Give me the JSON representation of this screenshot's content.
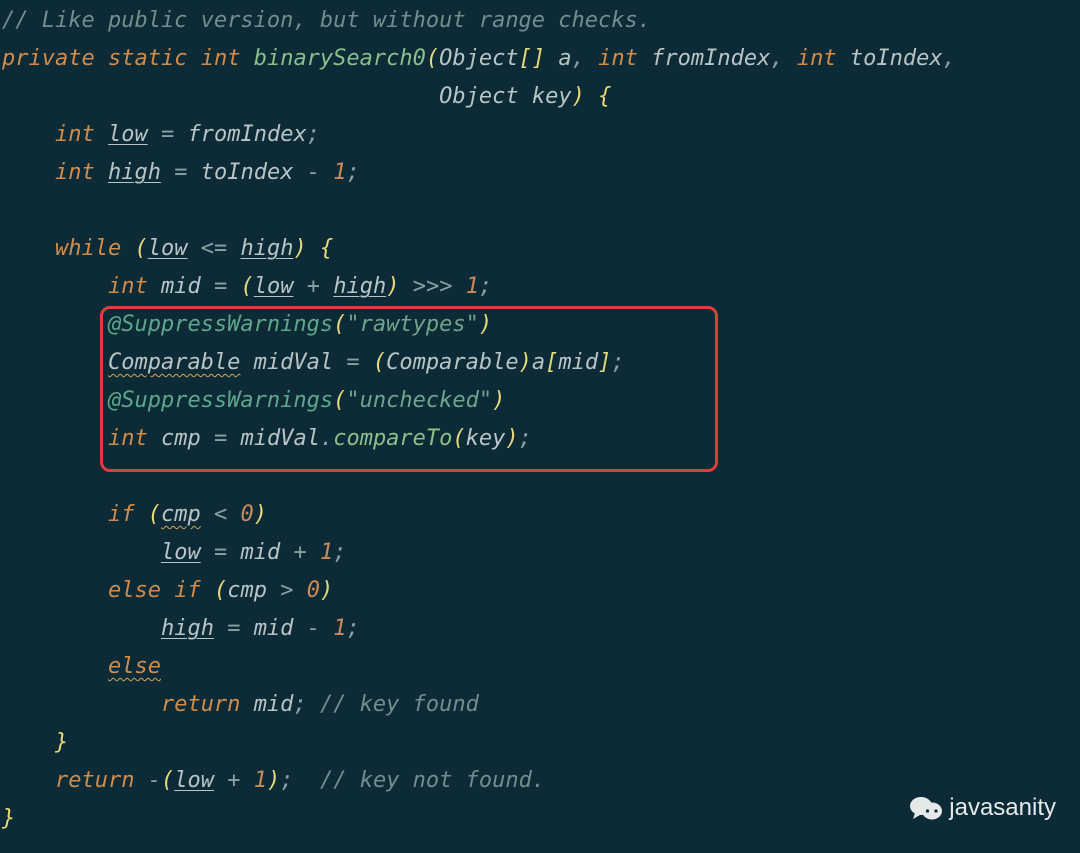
{
  "code": {
    "comment_top": "// Like public version, but without range checks.",
    "kw_private": "private",
    "kw_static": "static",
    "kw_int": "int",
    "method_name": "binarySearch0",
    "type_object": "Object",
    "param_a": "a",
    "param_fromIndex": "fromIndex",
    "param_toIndex": "toIndex",
    "param_key": "key",
    "var_low": "low",
    "var_high": "high",
    "var_mid": "mid",
    "kw_while": "while",
    "kw_if": "if",
    "kw_else": "else",
    "kw_return": "return",
    "annotation": "@SuppressWarnings",
    "str_rawtypes": "\"rawtypes\"",
    "str_unchecked": "\"unchecked\"",
    "type_comparable": "Comparable",
    "var_midVal": "midVal",
    "var_cmp": "cmp",
    "method_compareTo": "compareTo",
    "num_1": "1",
    "num_0": "0",
    "comment_found": "// key found",
    "comment_notfound": "// key not found.",
    "op_assign": "=",
    "op_minus": "-",
    "op_plus": "+",
    "op_le": "<=",
    "op_ushr": ">>>",
    "op_lt": "<",
    "op_gt": ">",
    "semi": ";",
    "comma": ",",
    "lparen": "(",
    "rparen": ")",
    "lbrace": "{",
    "rbrace": "}",
    "lbrack": "[",
    "rbrack": "]"
  },
  "watermark": {
    "text": "javasanity"
  }
}
